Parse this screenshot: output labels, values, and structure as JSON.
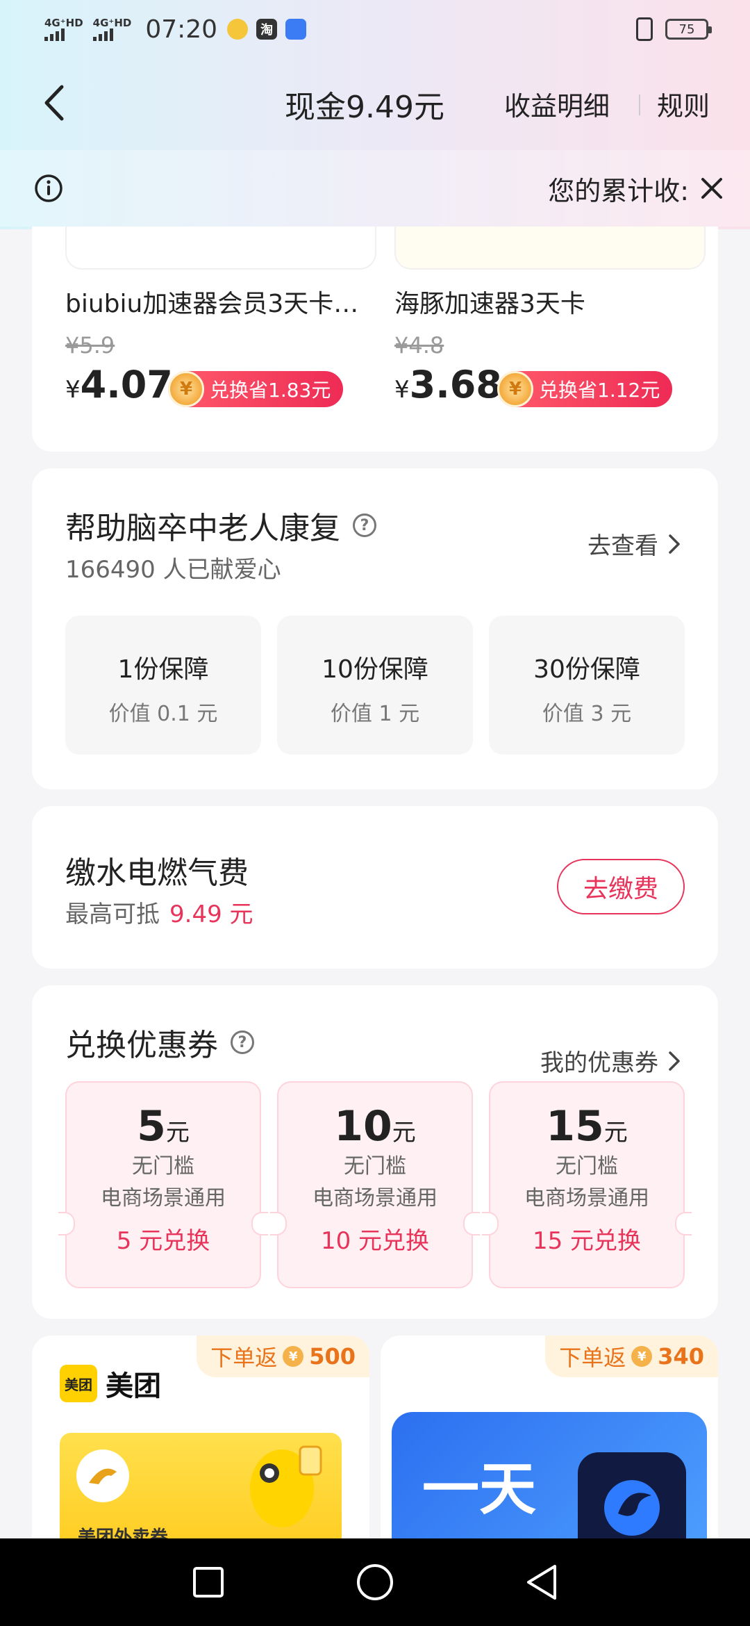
{
  "status_bar": {
    "signal_1": "4G⁺HD",
    "signal_2": "4G⁺HD",
    "time": "07:20",
    "app_icon_2": "淘",
    "battery": "75"
  },
  "nav": {
    "title": "现金9.49元",
    "link_details": "收益明细",
    "link_rules": "规则"
  },
  "notice": {
    "text": "您的累计收:"
  },
  "products": [
    {
      "name": "biubiu加速器会员3天卡…",
      "old_price": "¥5.9",
      "currency": "¥",
      "price": "4.07",
      "coin": "¥",
      "save": "兑换省1.83元"
    },
    {
      "name": "海豚加速器3天卡",
      "old_price": "¥4.8",
      "currency": "¥",
      "price": "3.68",
      "coin": "¥",
      "save": "兑换省1.12元"
    }
  ],
  "charity": {
    "title": "帮助脑卒中老人康复",
    "help": "?",
    "count": "166490  人已献爱心",
    "more": "去查看",
    "tiers": [
      {
        "title": "1份保障",
        "value": "价值  0.1  元"
      },
      {
        "title": "10份保障",
        "value": "价值  1  元"
      },
      {
        "title": "30份保障",
        "value": "价值  3  元"
      }
    ]
  },
  "bill": {
    "title": "缴水电燃气费",
    "sub_label": "最高可抵",
    "sub_value": "9.49  元",
    "button": "去缴费"
  },
  "coupons": {
    "title": "兑换优惠券",
    "help": "?",
    "more": "我的优惠券",
    "items": [
      {
        "amount": "5",
        "unit": "元",
        "line1": "无门槛",
        "line2": "电商场景通用",
        "button": "5  元兑换"
      },
      {
        "amount": "10",
        "unit": "元",
        "line1": "无门槛",
        "line2": "电商场景通用",
        "button": "10  元兑换"
      },
      {
        "amount": "15",
        "unit": "元",
        "line1": "无门槛",
        "line2": "电商场景通用",
        "button": "15  元兑换"
      }
    ]
  },
  "promos": [
    {
      "badge_label": "下单返",
      "coin": "¥",
      "badge_value": "500",
      "logo_box": "美团",
      "logo_name": "美团",
      "banner_text": "美团外卖券"
    },
    {
      "badge_label": "下单返",
      "coin": "¥",
      "badge_value": "340",
      "banner_text": "一天"
    }
  ],
  "colors": {
    "accent_red": "#e8335a",
    "orange": "#e8731a",
    "meituan_yellow": "#ffd100"
  }
}
